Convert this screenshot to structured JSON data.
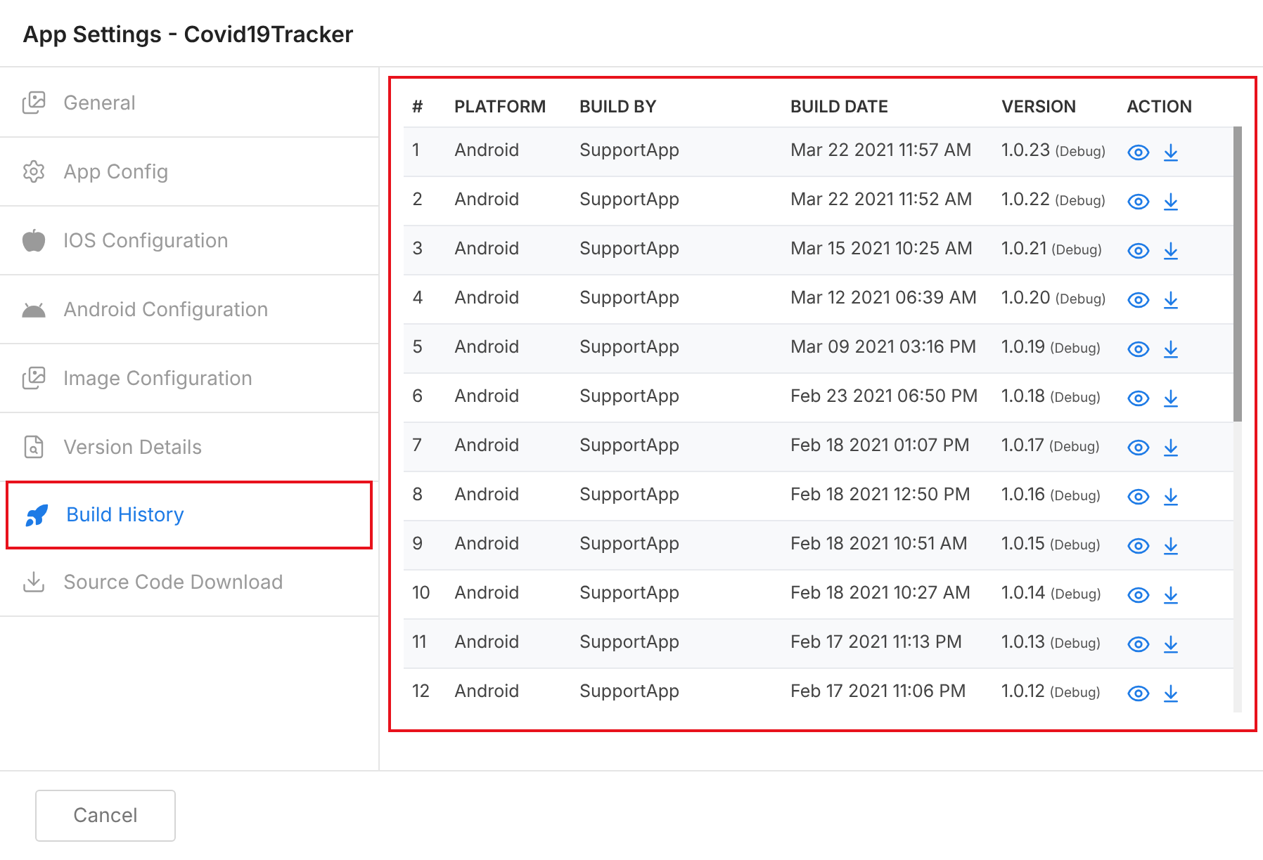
{
  "window": {
    "title": "App Settings - Covid19Tracker"
  },
  "sidebar": {
    "items": [
      {
        "kind": "images",
        "label": "General",
        "selected": false
      },
      {
        "kind": "gears",
        "label": "App Config",
        "selected": false
      },
      {
        "kind": "apple",
        "label": "IOS Configuration",
        "selected": false
      },
      {
        "kind": "android",
        "label": "Android Configuration",
        "selected": false
      },
      {
        "kind": "images",
        "label": "Image Configuration",
        "selected": false
      },
      {
        "kind": "file-search",
        "label": "Version Details",
        "selected": false
      },
      {
        "kind": "rocket",
        "label": "Build History",
        "selected": true
      },
      {
        "kind": "download",
        "label": "Source Code Download",
        "selected": false
      }
    ]
  },
  "build_table": {
    "highlighted": true,
    "columns": [
      "#",
      "PLATFORM",
      "BUILD BY",
      "BUILD DATE",
      "VERSION",
      "ACTION"
    ],
    "rows": [
      {
        "num": "1",
        "platform": "Android",
        "build_by": "SupportApp",
        "build_date": "Mar 22 2021 11:57 AM",
        "version": "1.0.23",
        "build_type": "(Debug)"
      },
      {
        "num": "2",
        "platform": "Android",
        "build_by": "SupportApp",
        "build_date": "Mar 22 2021 11:52 AM",
        "version": "1.0.22",
        "build_type": "(Debug)"
      },
      {
        "num": "3",
        "platform": "Android",
        "build_by": "SupportApp",
        "build_date": "Mar 15 2021 10:25 AM",
        "version": "1.0.21",
        "build_type": "(Debug)"
      },
      {
        "num": "4",
        "platform": "Android",
        "build_by": "SupportApp",
        "build_date": "Mar 12 2021 06:39 AM",
        "version": "1.0.20",
        "build_type": "(Debug)"
      },
      {
        "num": "5",
        "platform": "Android",
        "build_by": "SupportApp",
        "build_date": "Mar 09 2021 03:16 PM",
        "version": "1.0.19",
        "build_type": "(Debug)"
      },
      {
        "num": "6",
        "platform": "Android",
        "build_by": "SupportApp",
        "build_date": "Feb 23 2021 06:50 PM",
        "version": "1.0.18",
        "build_type": "(Debug)"
      },
      {
        "num": "7",
        "platform": "Android",
        "build_by": "SupportApp",
        "build_date": "Feb 18 2021 01:07 PM",
        "version": "1.0.17",
        "build_type": "(Debug)"
      },
      {
        "num": "8",
        "platform": "Android",
        "build_by": "SupportApp",
        "build_date": "Feb 18 2021 12:50 PM",
        "version": "1.0.16",
        "build_type": "(Debug)"
      },
      {
        "num": "9",
        "platform": "Android",
        "build_by": "SupportApp",
        "build_date": "Feb 18 2021 10:51 AM",
        "version": "1.0.15",
        "build_type": "(Debug)"
      },
      {
        "num": "10",
        "platform": "Android",
        "build_by": "SupportApp",
        "build_date": "Feb 18 2021 10:27 AM",
        "version": "1.0.14",
        "build_type": "(Debug)"
      },
      {
        "num": "11",
        "platform": "Android",
        "build_by": "SupportApp",
        "build_date": "Feb 17 2021 11:13 PM",
        "version": "1.0.13",
        "build_type": "(Debug)"
      },
      {
        "num": "12",
        "platform": "Android",
        "build_by": "SupportApp",
        "build_date": "Feb 17 2021 11:06 PM",
        "version": "1.0.12",
        "build_type": "(Debug)"
      }
    ]
  },
  "footer": {
    "cancel_button": "Cancel"
  }
}
